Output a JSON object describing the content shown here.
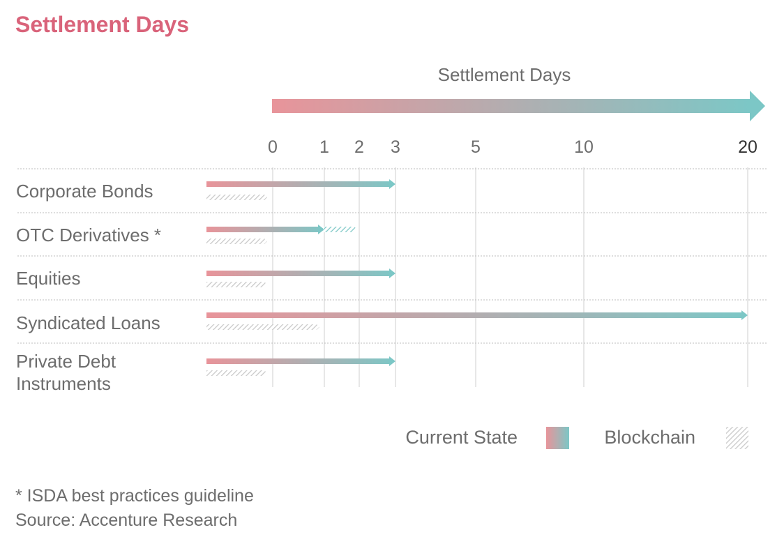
{
  "title": "Settlement Days",
  "colors": {
    "title": "#d9637a",
    "start": "#e8949a",
    "end": "#7cc7c6",
    "hatch": "#c8c8c8",
    "text": "#6d6d6d"
  },
  "chart_data": {
    "type": "bar",
    "orientation": "horizontal",
    "axis_title": "Settlement Days",
    "x_ticks": [
      0,
      1,
      2,
      3,
      5,
      10,
      20
    ],
    "x_scale": "nonlinear",
    "xlim": [
      0,
      20
    ],
    "grid": true,
    "legend_position": "bottom-right",
    "categories": [
      "Corporate Bonds",
      "OTC Derivatives *",
      "Equities",
      "Syndicated Loans",
      "Private Debt Instruments"
    ],
    "series": [
      {
        "name": "Current State",
        "values": [
          3,
          1,
          3,
          20,
          3
        ]
      },
      {
        "name": "Blockchain",
        "values": [
          0,
          0,
          0,
          1,
          0
        ]
      }
    ],
    "otc_extension_to": 2
  },
  "legend": {
    "current": "Current State",
    "blockchain": "Blockchain"
  },
  "footnote": "* ISDA best practices guideline",
  "source": "Source: Accenture Research"
}
